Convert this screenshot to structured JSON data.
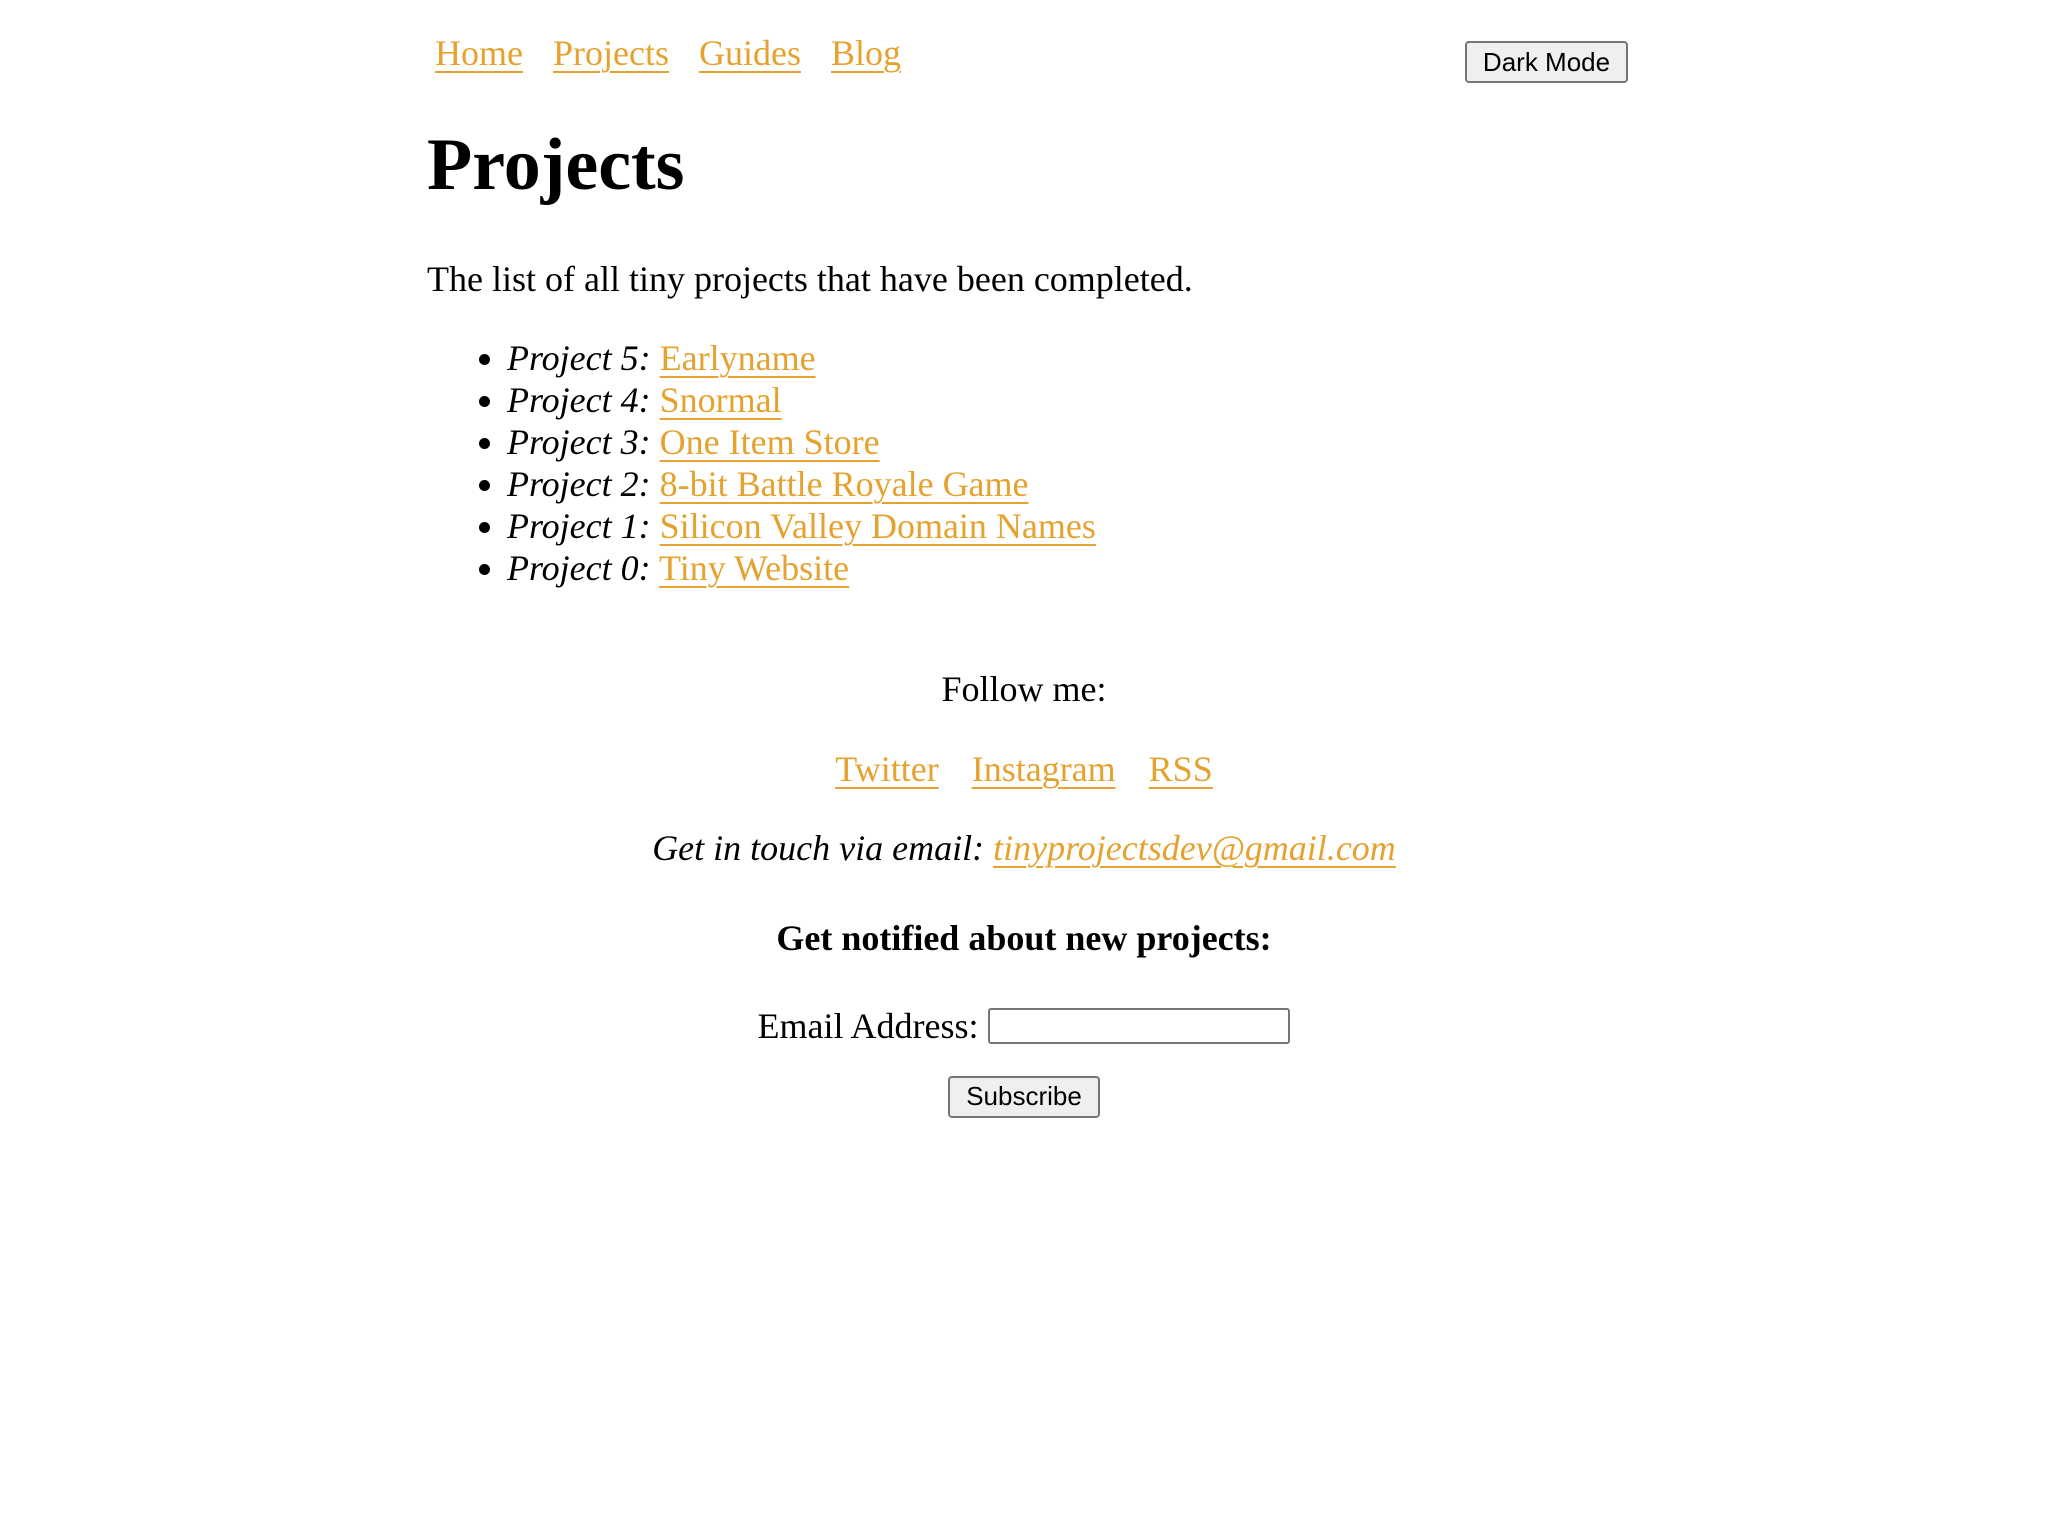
{
  "nav": {
    "items": [
      "Home",
      "Projects",
      "Guides",
      "Blog"
    ]
  },
  "dark_mode_label": "Dark Mode",
  "page": {
    "title": "Projects",
    "intro": "The list of all tiny projects that have been completed."
  },
  "projects": [
    {
      "prefix": "Project 5:",
      "name": "Earlyname"
    },
    {
      "prefix": "Project 4:",
      "name": "Snormal"
    },
    {
      "prefix": "Project 3:",
      "name": "One Item Store"
    },
    {
      "prefix": "Project 2:",
      "name": "8-bit Battle Royale Game"
    },
    {
      "prefix": "Project 1:",
      "name": "Silicon Valley Domain Names"
    },
    {
      "prefix": "Project 0:",
      "name": "Tiny Website"
    }
  ],
  "footer": {
    "follow": "Follow me:",
    "social": [
      "Twitter",
      "Instagram",
      "RSS"
    ],
    "contact_prefix": "Get in touch via email:",
    "contact_email": "tinyprojectsdev@gmail.com",
    "notify_heading": "Get notified about new projects:",
    "email_label": "Email Address:",
    "email_value": "",
    "subscribe_label": "Subscribe"
  },
  "colors": {
    "link": "#e5a22e",
    "text": "#000000",
    "background": "#ffffff"
  }
}
